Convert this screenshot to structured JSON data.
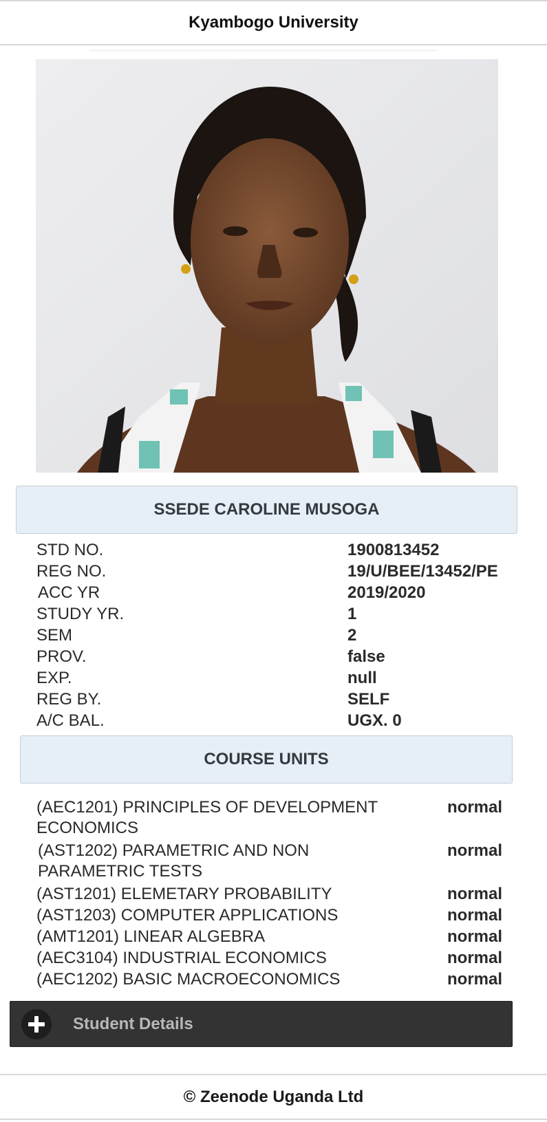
{
  "header": {
    "title": "Kyambogo University"
  },
  "student": {
    "photo_alt": "student photo",
    "name": "SSEDE CAROLINE MUSOGA",
    "details": [
      {
        "label": "STD NO.",
        "value": "1900813452"
      },
      {
        "label": "REG NO.",
        "value": "19/U/BEE/13452/PE"
      },
      {
        "label": "ACC YR",
        "value": "2019/2020"
      },
      {
        "label": "STUDY YR.",
        "value": "1"
      },
      {
        "label": "SEM",
        "value": "2"
      },
      {
        "label": "PROV.",
        "value": "false"
      },
      {
        "label": "EXP.",
        "value": "null"
      },
      {
        "label": "REG BY.",
        "value": "SELF"
      },
      {
        "label": "A/C BAL.",
        "value": "UGX. 0"
      }
    ]
  },
  "course_units": {
    "title": "COURSE UNITS",
    "items": [
      {
        "name": "(AEC1201) PRINCIPLES OF DEVELOPMENT ECONOMICS",
        "status": "normal"
      },
      {
        "name": "(AST1202) PARAMETRIC AND NON PARAMETRIC TESTS",
        "status": "normal"
      },
      {
        "name": "(AST1201) ELEMETARY PROBABILITY",
        "status": "normal"
      },
      {
        "name": "(AST1203) COMPUTER APPLICATIONS",
        "status": "normal"
      },
      {
        "name": "(AMT1201) LINEAR ALGEBRA",
        "status": "normal"
      },
      {
        "name": "(AEC3104) INDUSTRIAL ECONOMICS",
        "status": "normal"
      },
      {
        "name": "(AEC1202) BASIC MACROECONOMICS",
        "status": "normal"
      }
    ]
  },
  "student_details_section": {
    "label": "Student Details",
    "icon": "plus-icon",
    "expanded": false
  },
  "footer": {
    "text": "© Zeenode Uganda Ltd"
  },
  "colors": {
    "panel_bg": "#e6eef6",
    "collapsible_bg": "#333333",
    "collapsible_text": "#b8b8b8"
  }
}
